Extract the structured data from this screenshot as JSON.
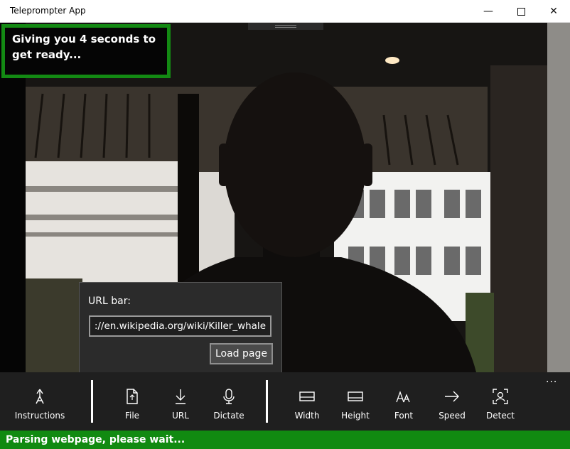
{
  "window": {
    "title": "Teleprompter App",
    "controls": [
      "minimize-icon",
      "maximize-icon",
      "close-icon"
    ]
  },
  "overlay": {
    "countdown_text": "Giving you 4 seconds to get ready..."
  },
  "url_flyout": {
    "label": "URL bar:",
    "url_value": "https://en.wikipedia.org/wiki/Killer_whale",
    "load_button": "Load page"
  },
  "appbar": {
    "buttons": [
      {
        "label": "Instructions",
        "icon": "instructions-icon"
      },
      {
        "label": "File",
        "icon": "file-icon"
      },
      {
        "label": "URL",
        "icon": "download-arrow-icon"
      },
      {
        "label": "Dictate",
        "icon": "microphone-icon"
      },
      {
        "label": "Width",
        "icon": "width-icon"
      },
      {
        "label": "Height",
        "icon": "height-icon"
      },
      {
        "label": "Font",
        "icon": "font-icon"
      },
      {
        "label": "Speed",
        "icon": "arrow-right-icon"
      },
      {
        "label": "Detect",
        "icon": "face-detect-icon"
      }
    ],
    "more": "..."
  },
  "status": {
    "text": "Parsing webpage, please wait..."
  },
  "colors": {
    "accent_green": "#138a13",
    "appbar_bg": "#1f1f1f",
    "flyout_bg": "#2b2b2b"
  }
}
